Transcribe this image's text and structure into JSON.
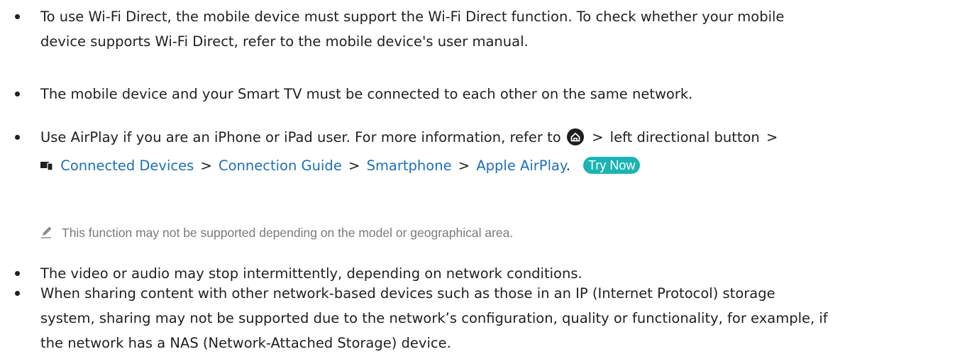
{
  "bullets": [
    {
      "lines": [
        "To use Wi-Fi Direct, the mobile device must support the Wi-Fi Direct function. To check whether your mobile",
        "device supports Wi-Fi Direct, refer to the mobile device's user manual."
      ]
    },
    {
      "lines": [
        "The mobile device and your Smart TV must be connected to each other on the same network."
      ]
    },
    {
      "line1_text": "Use AirPlay if you are an iPhone or iPad user. For more information, refer to",
      "line1_after_icon": "left directional button",
      "path": [
        "Connected Devices",
        "Connection Guide",
        "Smartphone",
        "Apple AirPlay"
      ],
      "period": ".",
      "try_now": "Try Now",
      "separator": ">",
      "note": "This function may not be supported depending on the model or geographical area."
    },
    {
      "lines": [
        "The video or audio may stop intermittently, depending on network conditions."
      ]
    },
    {
      "lines": [
        "When sharing content with other network-based devices such as those in an IP (Internet Protocol) storage",
        "system, sharing may not be supported due to the network’s configuration, quality or functionality, for example, if",
        "the network has a NAS (Network-Attached Storage) device."
      ]
    }
  ],
  "icons": {
    "home": "home-icon",
    "devices": "connected-devices-icon",
    "note": "pencil-note-icon"
  },
  "colors": {
    "text": "#1f1f1f",
    "link": "#1a6fbf",
    "try_now_bg": "#1ab4b4",
    "note_text": "#7a7a7a"
  }
}
